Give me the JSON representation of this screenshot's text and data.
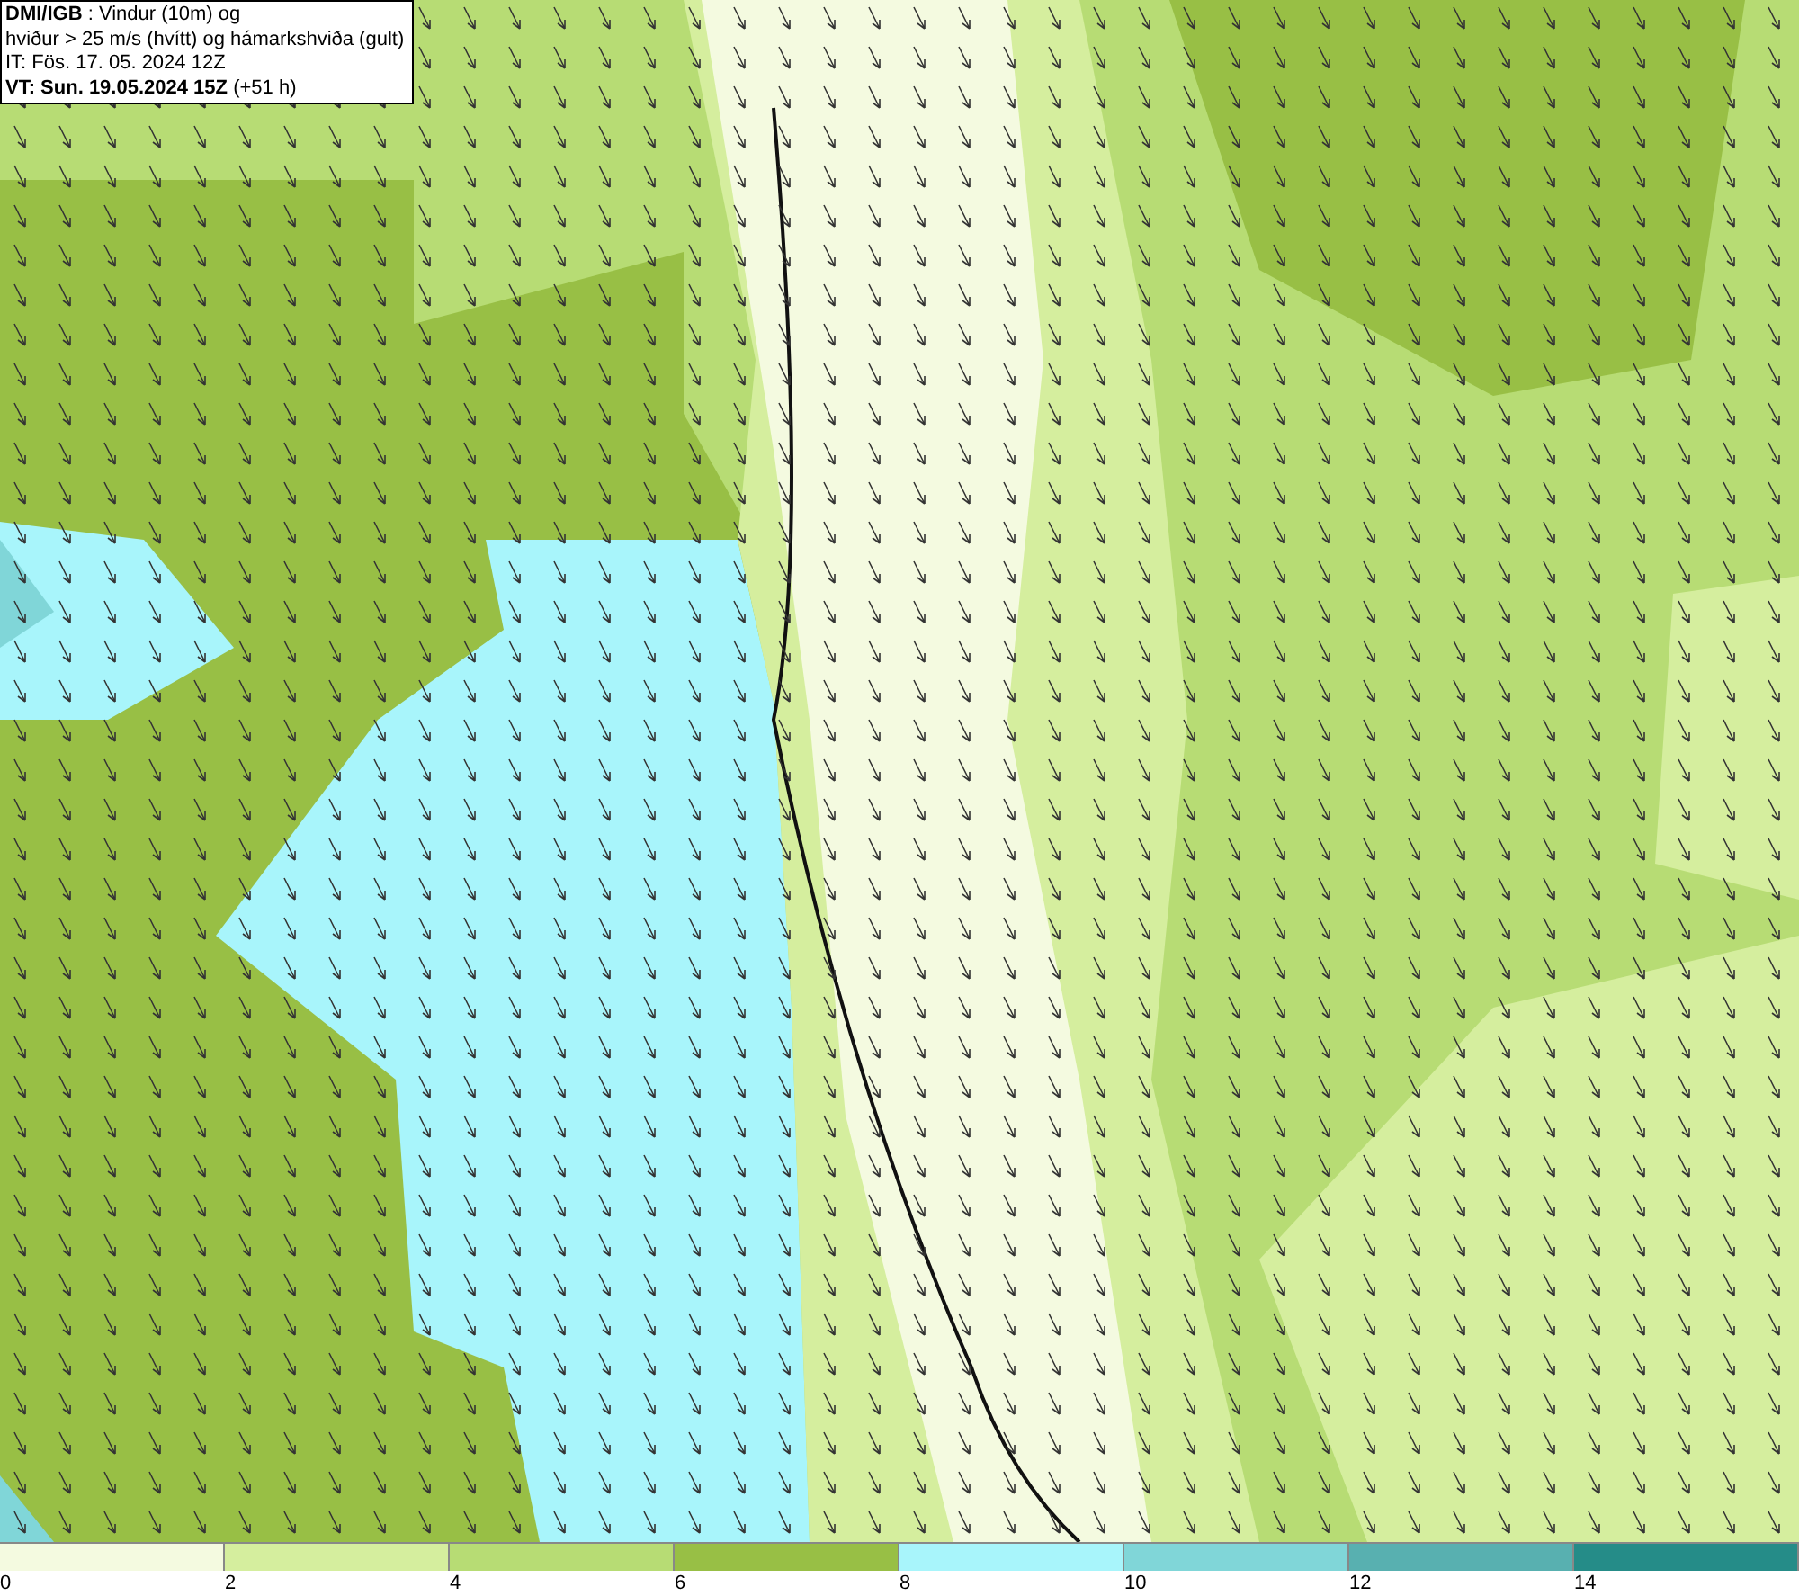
{
  "map_title": {
    "lines": [
      "**DMI/IGB** : Vindur (10m) og",
      "hviður > 25 m/s (hvítt) og hámarkshviða (gult)",
      "IT: Fös. 17. 05. 2024 12Z",
      "**VT: Sun. 19.05.2024 15Z** (+51 h)"
    ]
  },
  "colorbar": {
    "segments": [
      {
        "color": "#f4fae0"
      },
      {
        "color": "#d5ee9e"
      },
      {
        "color": "#b7dc74"
      },
      {
        "color": "#98bf45"
      },
      {
        "color": "#a8f5fb"
      },
      {
        "color": "#80d6d8"
      },
      {
        "color": "#58b0b0"
      },
      {
        "color": "#258c88"
      }
    ],
    "ticks": [
      "0",
      "2",
      "4",
      "6",
      "8",
      "10",
      "12",
      "14"
    ]
  }
}
